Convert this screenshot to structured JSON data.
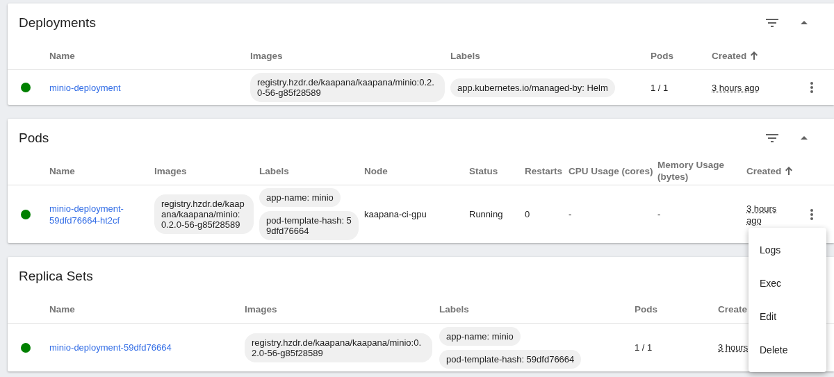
{
  "sections": [
    {
      "title": "Deployments",
      "toolbar": true,
      "columns": [
        {
          "label": "Name",
          "sorted": false
        },
        {
          "label": "Images",
          "sorted": false
        },
        {
          "label": "Labels",
          "sorted": false
        },
        {
          "label": "Pods",
          "sorted": false
        },
        {
          "label": "Created",
          "sorted": true
        }
      ],
      "rows": [
        {
          "color": "#008000",
          "menu": true,
          "cells": [
            {
              "kind": "link",
              "text": "minio-deployment"
            },
            {
              "kind": "chips",
              "items": [
                "registry.hzdr.de/kaapana/kaapana/minio:0.2.0-56-g85f28589"
              ]
            },
            {
              "kind": "chips",
              "items": [
                "app.kubernetes.io/managed-by: Helm"
              ]
            },
            {
              "kind": "text",
              "text": "1 / 1"
            },
            {
              "kind": "time",
              "text": "3 hours ago"
            }
          ]
        }
      ]
    },
    {
      "title": "Pods",
      "toolbar": true,
      "columns": [
        {
          "label": "Name",
          "sorted": false
        },
        {
          "label": "Images",
          "sorted": false
        },
        {
          "label": "Labels",
          "sorted": false
        },
        {
          "label": "Node",
          "sorted": false
        },
        {
          "label": "Status",
          "sorted": false
        },
        {
          "label": "Restarts",
          "sorted": false
        },
        {
          "label": "CPU Usage (cores)",
          "sorted": false
        },
        {
          "label": "Memory Usage (bytes)",
          "sorted": false
        },
        {
          "label": "Created",
          "sorted": true
        }
      ],
      "rows": [
        {
          "color": "#008000",
          "menu": true,
          "cells": [
            {
              "kind": "link",
              "text": "minio-deployment-59dfd76664-ht2cf"
            },
            {
              "kind": "chips",
              "items": [
                "registry.hzdr.de/kaapana/kaapana/minio:0.2.0-56-g85f28589"
              ]
            },
            {
              "kind": "chips",
              "items": [
                "app-name: minio",
                "pod-template-hash: 59dfd76664"
              ]
            },
            {
              "kind": "text",
              "text": "kaapana-ci-gpu"
            },
            {
              "kind": "text",
              "text": "Running"
            },
            {
              "kind": "text",
              "text": "0"
            },
            {
              "kind": "text",
              "text": "-"
            },
            {
              "kind": "text",
              "text": "-"
            },
            {
              "kind": "time",
              "text": "3 hours ago"
            }
          ]
        }
      ]
    },
    {
      "title": "Replica Sets",
      "toolbar": false,
      "columns": [
        {
          "label": "Name",
          "sorted": false
        },
        {
          "label": "Images",
          "sorted": false
        },
        {
          "label": "Labels",
          "sorted": false
        },
        {
          "label": "Pods",
          "sorted": false
        },
        {
          "label": "Create",
          "sorted": false
        }
      ],
      "rows": [
        {
          "color": "#008000",
          "menu": false,
          "cells": [
            {
              "kind": "link",
              "text": "minio-deployment-59dfd76664"
            },
            {
              "kind": "chips",
              "items": [
                "registry.hzdr.de/kaapana/kaapana/minio:0.2.0-56-g85f28589"
              ]
            },
            {
              "kind": "chips",
              "items": [
                "app-name: minio",
                "pod-template-hash: 59dfd76664"
              ]
            },
            {
              "kind": "text",
              "text": "1 / 1"
            },
            {
              "kind": "time",
              "text": "3 hours"
            }
          ]
        }
      ]
    }
  ],
  "menu": [
    "Logs",
    "Exec",
    "Edit",
    "Delete"
  ]
}
